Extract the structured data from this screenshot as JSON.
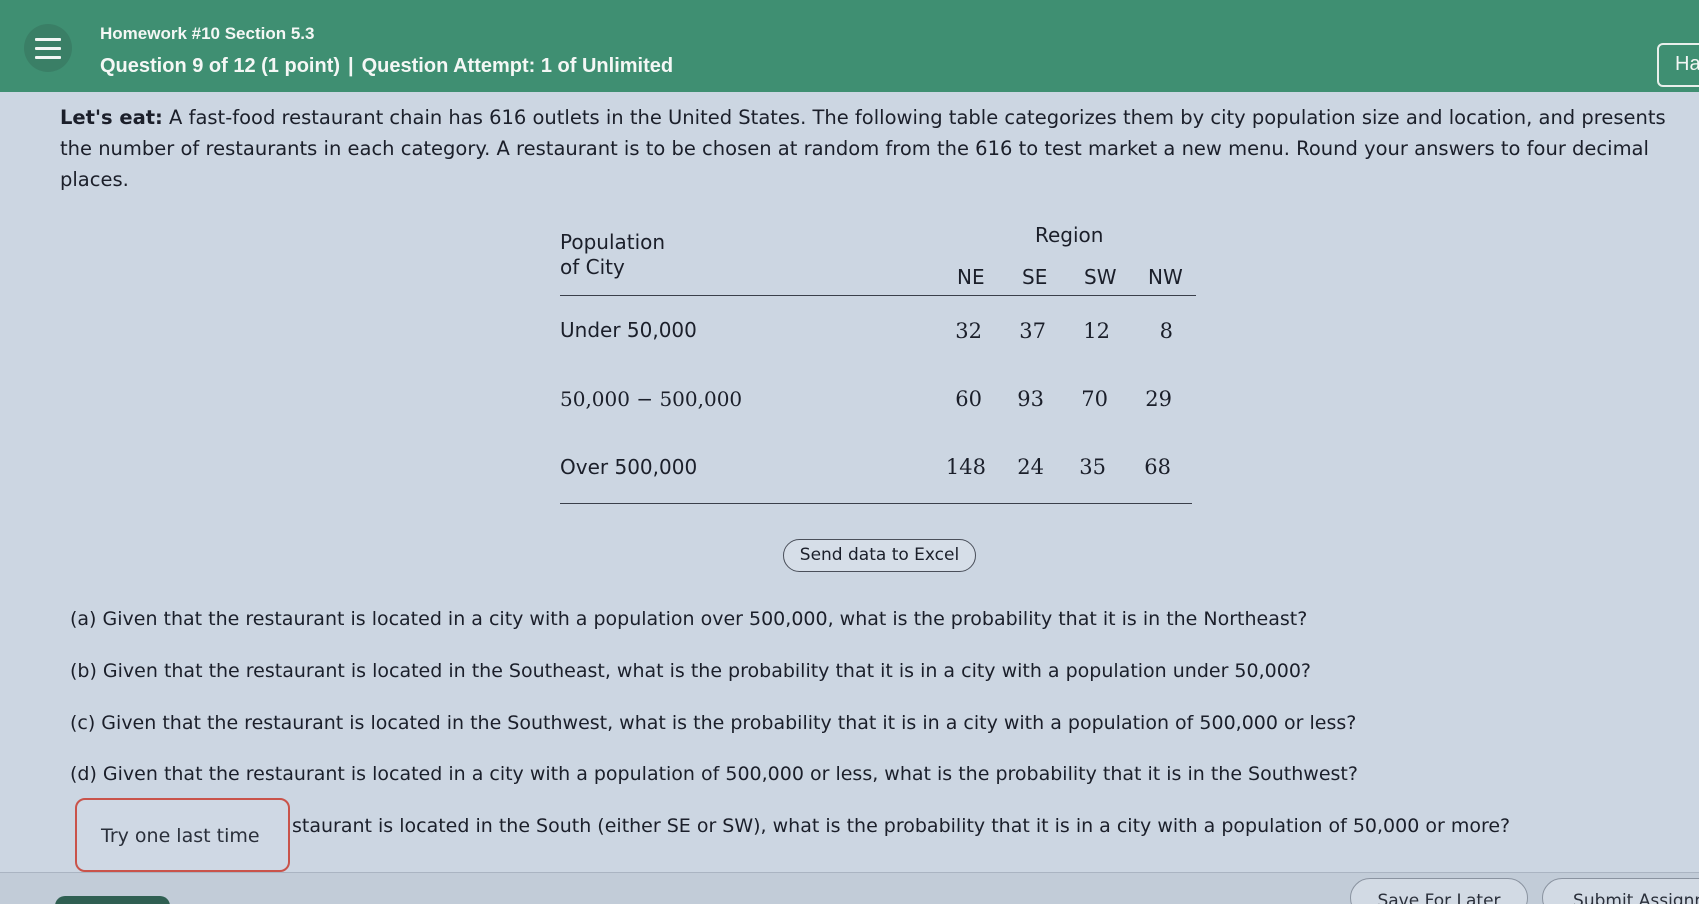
{
  "header": {
    "homework_title": "Homework #10 Section 5.3",
    "question_label": "Question 9 of 12 (1 point)",
    "separator": "|",
    "attempt_label": "Question Attempt: 1 of Unlimited",
    "help_label": "Ha"
  },
  "problem": {
    "lead": "Let's eat:",
    "intro": "A fast-food restaurant chain has 616 outlets in the United States. The following table categorizes them by city population size and location, and presents the number of restaurants in each category. A restaurant is to be chosen at random from the 616 to test market a new menu. Round your answers to four decimal places."
  },
  "table": {
    "row_header_line1": "Population",
    "row_header_line2": "of City",
    "group_header": "Region",
    "columns": [
      "NE",
      "SE",
      "SW",
      "NW"
    ],
    "rows": [
      {
        "label": "Under 50,000",
        "values": [
          "32",
          "37",
          "12",
          "8"
        ]
      },
      {
        "label": "50,000 − 500,000",
        "values": [
          "60",
          "93",
          "70",
          "29"
        ]
      },
      {
        "label": "Over 500,000",
        "values": [
          "148",
          "24",
          "35",
          "68"
        ]
      }
    ]
  },
  "excel_button": "Send data to Excel",
  "questions": [
    "(a) Given that the restaurant is located in a city with a population over 500,000, what is the probability that it is in the Northeast?",
    "(b) Given that the restaurant is located in the Southeast, what is the probability that it is in a city with a population under 50,000?",
    "(c) Given that the restaurant is located in the Southwest, what is the probability that it is in a city with a population of 500,000 or less?",
    "(d) Given that the restaurant is located in a city with a population of 500,000 or less, what is the probability that it is in the Southwest?",
    "staurant is located in the South (either SE or SW), what is the probability that it is in a city with a population of 50,000 or more?"
  ],
  "try_again_label": "Try one last time",
  "footer": {
    "save_label": "Save For Later",
    "submit_label": "Submit Assignm"
  },
  "colors": {
    "header_green": "#3f8f72",
    "page_background": "#ccd6e2",
    "try_border": "#c9534a"
  }
}
